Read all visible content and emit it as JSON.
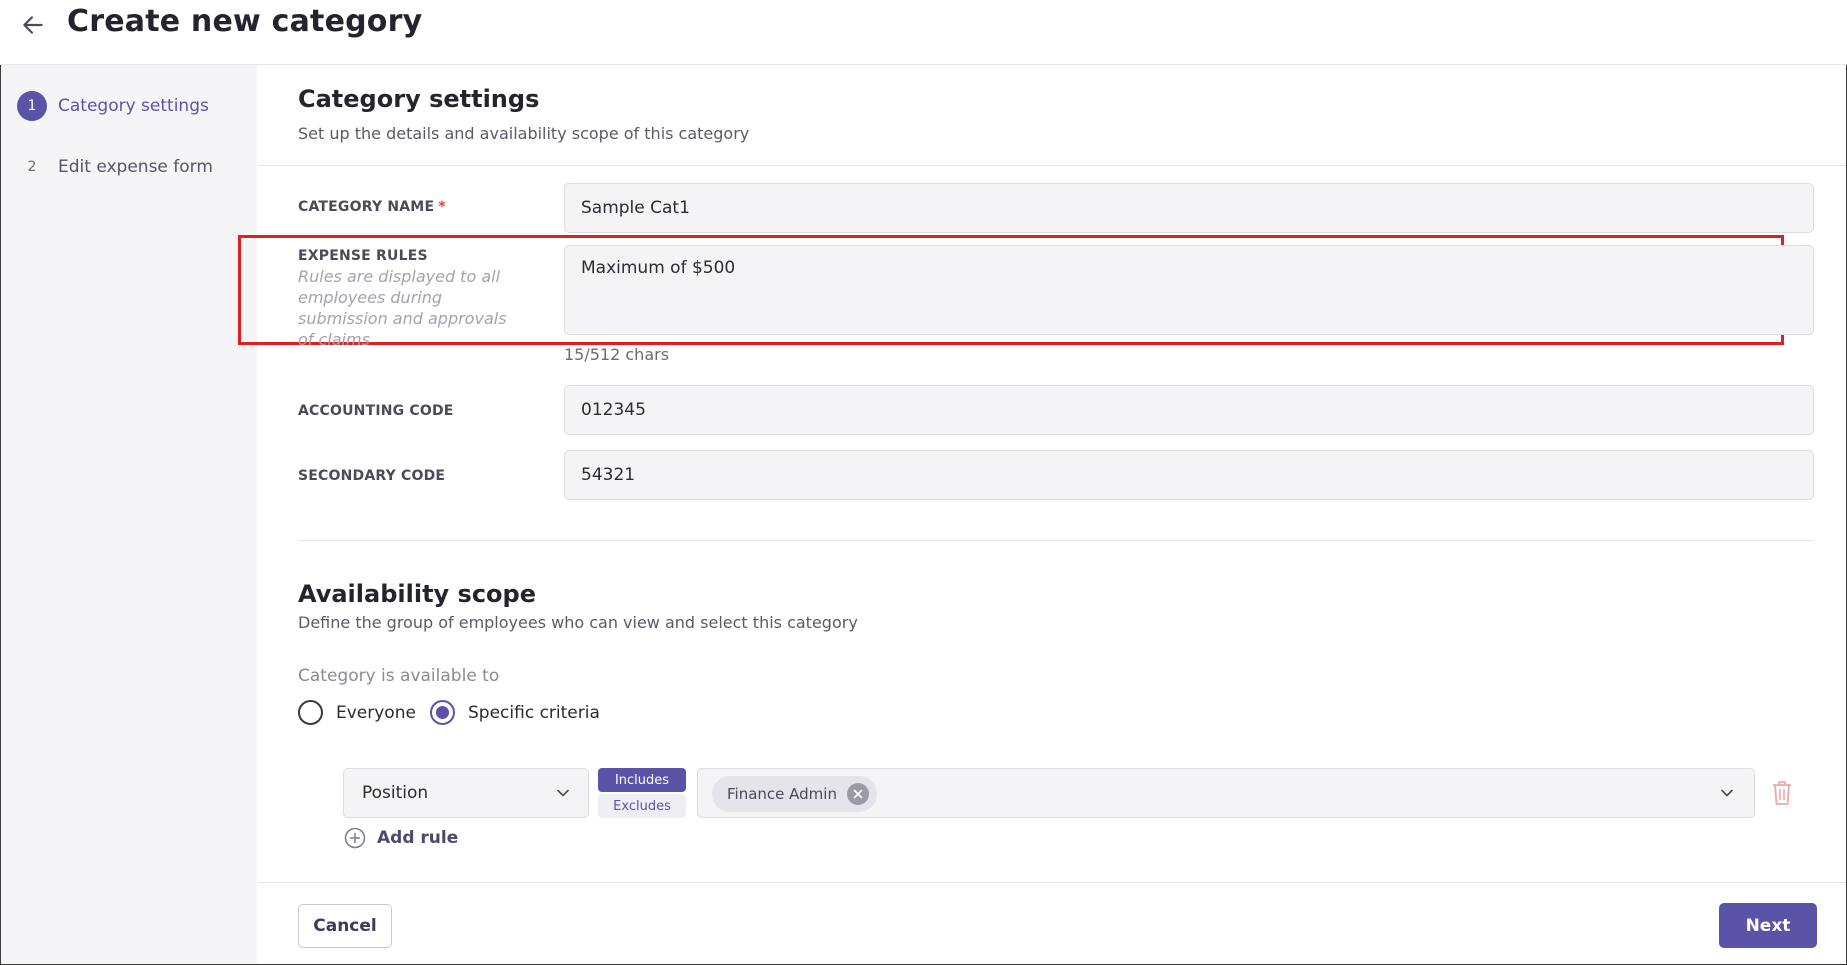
{
  "header": {
    "title": "Create new category",
    "back_icon": "arrow-left-icon"
  },
  "sidebar": {
    "steps": [
      {
        "number": "1",
        "label": "Category settings",
        "active": true
      },
      {
        "number": "2",
        "label": "Edit expense form",
        "active": false
      }
    ]
  },
  "category_settings": {
    "title": "Category settings",
    "subtitle": "Set up the details and availability scope of this category",
    "fields": {
      "category_name": {
        "label": "CATEGORY NAME",
        "required_mark": "*",
        "value": "Sample Cat1"
      },
      "expense_rules": {
        "label": "EXPENSE RULES",
        "hint": "Rules are displayed to all employees during submission and approvals of claims",
        "value": "Maximum of $500",
        "char_count": "15/512 chars"
      },
      "accounting_code": {
        "label": "ACCOUNTING CODE",
        "value": "012345"
      },
      "secondary_code": {
        "label": "SECONDARY CODE",
        "value": "54321"
      }
    }
  },
  "availability_scope": {
    "title": "Availability scope",
    "subtitle": "Define the group of employees who can view and select this category",
    "available_to_label": "Category is available to",
    "options": [
      {
        "label": "Everyone",
        "selected": false
      },
      {
        "label": "Specific criteria",
        "selected": true
      }
    ],
    "rule": {
      "attribute": "Position",
      "mode_options": [
        "Includes",
        "Excludes"
      ],
      "selected_mode": "Includes",
      "values": [
        "Finance Admin"
      ]
    },
    "add_rule_label": "Add rule"
  },
  "footer": {
    "cancel_label": "Cancel",
    "next_label": "Next"
  },
  "colors": {
    "accent": "#5b53a8",
    "highlight": "#e02020",
    "delete": "#f0a8a8"
  }
}
